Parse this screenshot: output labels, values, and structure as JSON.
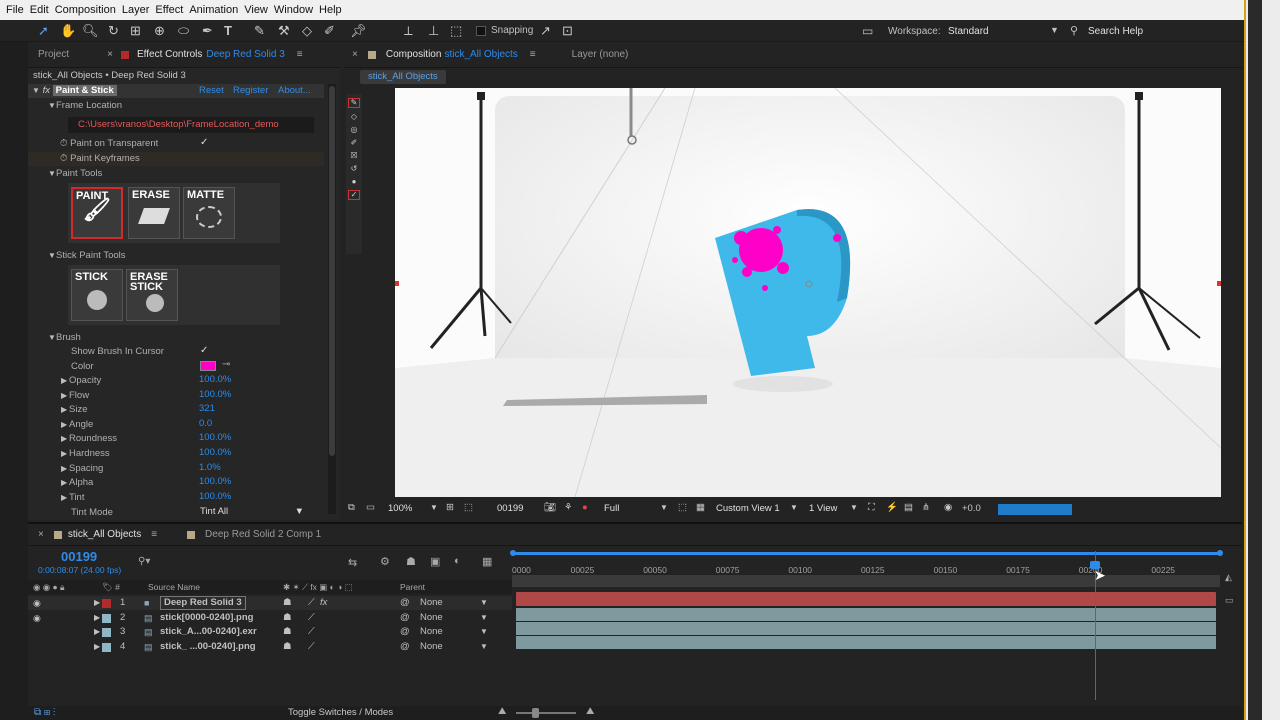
{
  "menu": [
    "File",
    "Edit",
    "Composition",
    "Layer",
    "Effect",
    "Animation",
    "View",
    "Window",
    "Help"
  ],
  "toolbar": {
    "snapping": "Snapping",
    "workspace_label": "Workspace:",
    "workspace_value": "Standard",
    "search_help": "Search Help"
  },
  "left_panel": {
    "tab_project": "Project",
    "tab_effect_controls": "Effect Controls",
    "tab_layer_name": "Deep Red Solid 3",
    "breadcrumb": "stick_All Objects • Deep Red Solid 3",
    "effect": {
      "name": "Paint & Stick",
      "reset": "Reset",
      "register": "Register",
      "about": "About..."
    },
    "frame_location": {
      "label": "Frame Location",
      "path": "C:\\Users\\vranos\\Desktop\\FrameLocation_demo"
    },
    "paint_on_transparent": "Paint on Transparent",
    "paint_keyframes": "Paint Keyframes",
    "paint_tools": {
      "label": "Paint Tools",
      "paint": "PAINT",
      "erase": "ERASE",
      "matte": "MATTE"
    },
    "stick_paint_tools": {
      "label": "Stick Paint Tools",
      "stick": "STICK",
      "erase_stick_1": "ERASE",
      "erase_stick_2": "STICK"
    },
    "brush": {
      "label": "Brush",
      "show_brush": "Show Brush In Cursor",
      "color_label": "Color",
      "color": "#ff00c8",
      "props": [
        {
          "label": "Opacity",
          "value": "100.0%"
        },
        {
          "label": "Flow",
          "value": "100.0%"
        },
        {
          "label": "Size",
          "value": "321"
        },
        {
          "label": "Angle",
          "value": "0.0"
        },
        {
          "label": "Roundness",
          "value": "100.0%"
        },
        {
          "label": "Hardness",
          "value": "100.0%"
        },
        {
          "label": "Spacing",
          "value": "1.0%"
        },
        {
          "label": "Alpha",
          "value": "100.0%"
        },
        {
          "label": "Tint",
          "value": "100.0%"
        }
      ],
      "tint_mode_label": "Tint Mode",
      "tint_mode_value": "Tint All"
    }
  },
  "comp_panel": {
    "tab_composition": "Composition",
    "tab_comp_name": "stick_All Objects",
    "tab_layer": "Layer (none)",
    "sub_tab": "stick_All Objects",
    "footer": {
      "zoom": "100%",
      "frame": "00199",
      "resolution": "Full",
      "view": "Custom View 1",
      "views": "1 View",
      "exposure": "+0.0"
    }
  },
  "timeline": {
    "tab_active": "stick_All Objects",
    "tab_other": "Deep Red Solid 2 Comp 1",
    "current_frame": "00199",
    "current_time": "0:00:08:07 (24.00 fps)",
    "col_source": "Source Name",
    "col_parent": "Parent",
    "layers": [
      {
        "num": "1",
        "name": "Deep Red Solid 3",
        "parent": "None",
        "color": "#b22a2a"
      },
      {
        "num": "2",
        "name": "stick[0000-0240].png",
        "parent": "None",
        "color": "#8fb7c4"
      },
      {
        "num": "3",
        "name": "stick_A...00-0240].exr",
        "parent": "None",
        "color": "#8fb7c4"
      },
      {
        "num": "4",
        "name": "stick_ ...00-0240].png",
        "parent": "None",
        "color": "#8fb7c4"
      }
    ],
    "ticks": [
      "0000",
      "00025",
      "00050",
      "00075",
      "00100",
      "00125",
      "00150",
      "00175",
      "00200",
      "00225"
    ],
    "footer_label": "Toggle Switches / Modes"
  }
}
